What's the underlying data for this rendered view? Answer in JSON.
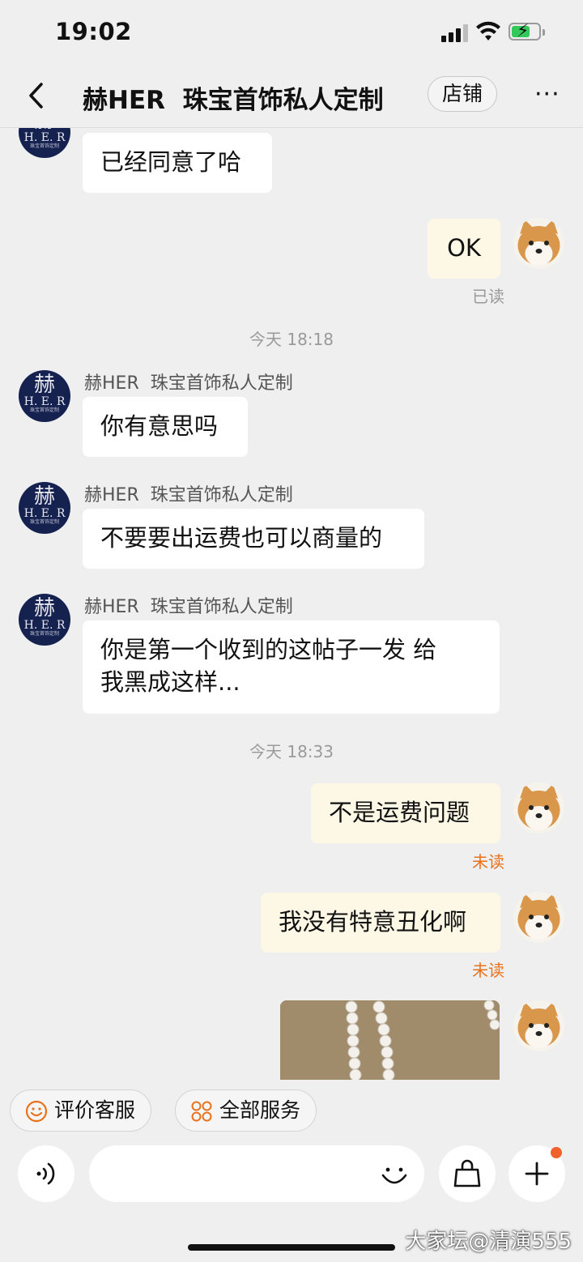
{
  "status_bar": {
    "time": "19:02"
  },
  "header": {
    "title": "赫HER  珠宝首饰私人定制",
    "shop_button": "店铺",
    "more": "···"
  },
  "shop_avatar": {
    "glyph": "赫",
    "text": "H. E. R",
    "small": "珠宝首饰定制"
  },
  "messages": {
    "m1": {
      "text": "已经同意了哈"
    },
    "m2": {
      "text": "OK",
      "status": "已读"
    },
    "t1": "今天 18:18",
    "m3": {
      "sender": "赫HER  珠宝首饰私人定制",
      "text": "你有意思吗"
    },
    "m4": {
      "sender": "赫HER  珠宝首饰私人定制",
      "text": "不要要出运费也可以商量的"
    },
    "m5": {
      "sender": "赫HER  珠宝首饰私人定制",
      "line1": "你是第一个收到的这帖子一发 给",
      "line2": "我黑成这样..."
    },
    "t2": "今天 18:33",
    "m6": {
      "text": "不是运费问题",
      "status": "未读"
    },
    "m7": {
      "text": "我没有特意丑化啊",
      "status": "未读"
    }
  },
  "quick_actions": {
    "rate": "评价客服",
    "services": "全部服务"
  },
  "input_bar": {
    "voice_icon": "voice-icon",
    "emoji_icon": "smile-icon",
    "bag_icon": "bag-icon",
    "plus_icon": "plus-icon"
  },
  "watermark": "大家坛@清演555",
  "colors": {
    "unread": "#e8711c",
    "outgoing_bubble": "#fdf8e6",
    "shop_avatar_bg": "#15224f",
    "accent": "#f0612b"
  }
}
